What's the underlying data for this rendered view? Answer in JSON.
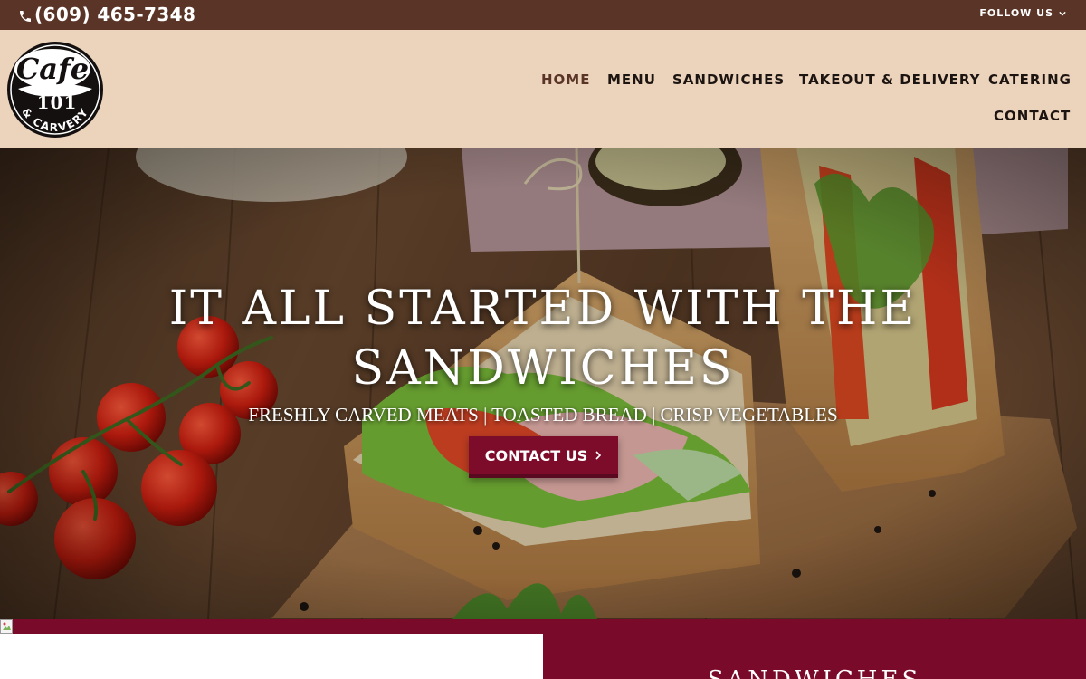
{
  "topbar": {
    "phone": "(609) 465-7348",
    "follow_label": "FOLLOW US",
    "phone_icon": "phone-icon",
    "follow_icon": "chevron-down-icon"
  },
  "header": {
    "logo": {
      "name": "cafe-101-carvery-logo",
      "wordmark_top": "Cafe",
      "wordmark_number": "101",
      "wordmark_bottom": "& CARVERY"
    },
    "nav": [
      {
        "label": "HOME",
        "active": true
      },
      {
        "label": "MENU",
        "active": false
      },
      {
        "label": "SANDWICHES",
        "active": false
      },
      {
        "label": "TAKEOUT & DELIVERY",
        "active": false
      },
      {
        "label": "CATERING",
        "active": false
      },
      {
        "label": "CONTACT",
        "active": false
      }
    ]
  },
  "hero": {
    "title_line1": "IT ALL STARTED WITH THE",
    "title_line2": "SANDWICHES",
    "subtitle": "FRESHLY CARVED MEATS | TOASTED BREAD | CRISP VEGETABLES",
    "cta_label": "CONTACT US",
    "cta_icon": "chevron-right-icon"
  },
  "section": {
    "title": "SANDWICHES"
  },
  "colors": {
    "topbar_bg": "#5a3527",
    "header_bg": "#ecd3bc",
    "accent": "#7d0b2a",
    "nav_active": "#5a3527"
  }
}
